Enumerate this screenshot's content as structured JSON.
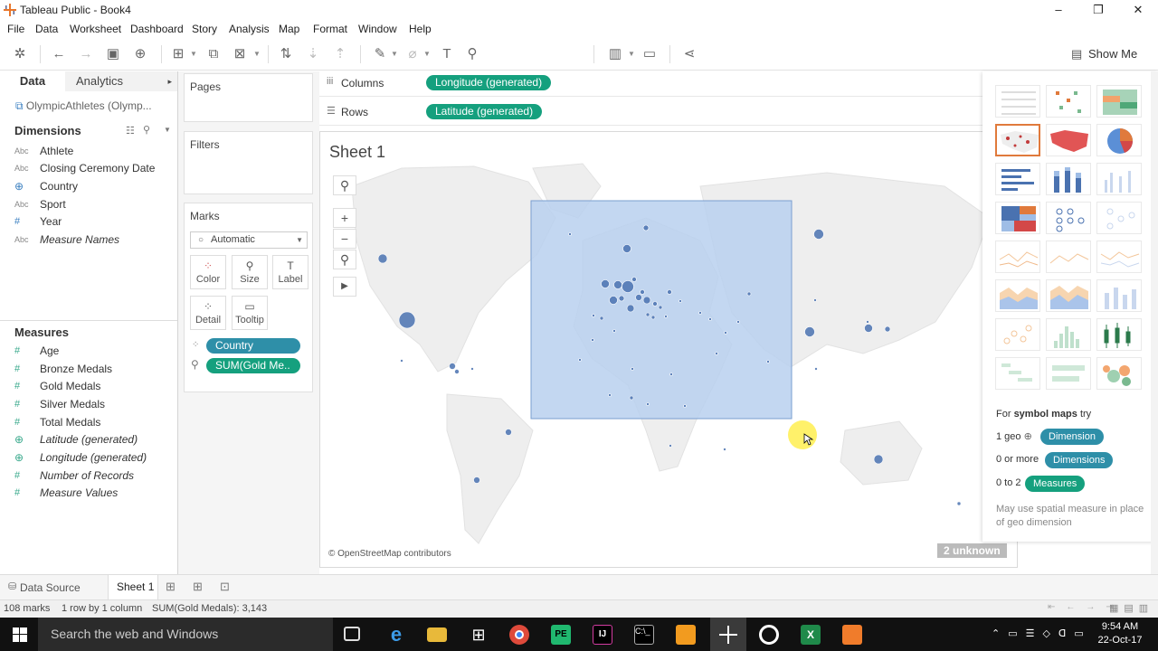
{
  "window": {
    "title": "Tableau Public - Book4"
  },
  "menu": [
    "File",
    "Data",
    "Worksheet",
    "Dashboard",
    "Story",
    "Analysis",
    "Map",
    "Format",
    "Window",
    "Help"
  ],
  "toolbar": {
    "show_me_label": "Show Me"
  },
  "data_pane": {
    "tabs": [
      "Data",
      "Analytics"
    ],
    "datasource": "OlympicAthletes (Olymp...",
    "dimensions_title": "Dimensions",
    "dimensions": [
      {
        "type": "Abc",
        "label": "Athlete"
      },
      {
        "type": "Abc",
        "label": "Closing Ceremony Date"
      },
      {
        "type": "geo",
        "label": "Country"
      },
      {
        "type": "Abc",
        "label": "Sport"
      },
      {
        "type": "#",
        "label": "Year"
      },
      {
        "type": "Abc",
        "label": "Measure Names"
      }
    ],
    "measures_title": "Measures",
    "measures": [
      {
        "type": "#",
        "label": "Age"
      },
      {
        "type": "#",
        "label": "Bronze Medals"
      },
      {
        "type": "#",
        "label": "Gold Medals"
      },
      {
        "type": "#",
        "label": "Silver Medals"
      },
      {
        "type": "#",
        "label": "Total Medals"
      },
      {
        "type": "geo",
        "label": "Latitude (generated)"
      },
      {
        "type": "geo",
        "label": "Longitude (generated)"
      },
      {
        "type": "#",
        "label": "Number of Records"
      },
      {
        "type": "#",
        "label": "Measure Values"
      }
    ]
  },
  "shelves": {
    "pages": "Pages",
    "filters": "Filters",
    "marks": "Marks",
    "mark_type": "Automatic",
    "buttons": [
      "Color",
      "Size",
      "Label",
      "Detail",
      "Tooltip"
    ],
    "pills": [
      "Country",
      "SUM(Gold Me.."
    ],
    "columns_label": "Columns",
    "rows_label": "Rows",
    "columns_pill": "Longitude (generated)",
    "rows_pill": "Latitude (generated)"
  },
  "view": {
    "sheet_title": "Sheet 1",
    "attribution": "© OpenStreetMap contributors",
    "unknown_badge": "2 unknown"
  },
  "show_me": {
    "hint_prefix": "For",
    "hint_bold": "symbol maps",
    "hint_suffix": "try",
    "rows": [
      {
        "count": "1 geo",
        "pill": "Dimension"
      },
      {
        "count": "0 or more",
        "pill": "Dimensions"
      },
      {
        "count": "0 to 2",
        "pill": "Measures"
      }
    ],
    "note": "May use spatial measure in place of geo dimension"
  },
  "tabs": {
    "data_source": "Data Source",
    "sheet": "Sheet 1"
  },
  "status": {
    "marks": "108 marks",
    "rows_cols": "1 row by 1 column",
    "sum": "SUM(Gold Medals): 3,143"
  },
  "taskbar": {
    "search": "Search the web and Windows",
    "time": "9:54 AM",
    "date": "22-Oct-17"
  },
  "colors": {
    "dimension": "#2e8fa8",
    "measure": "#15a07e",
    "mark": "#4a72b0",
    "selection": "#b8d0ee"
  }
}
